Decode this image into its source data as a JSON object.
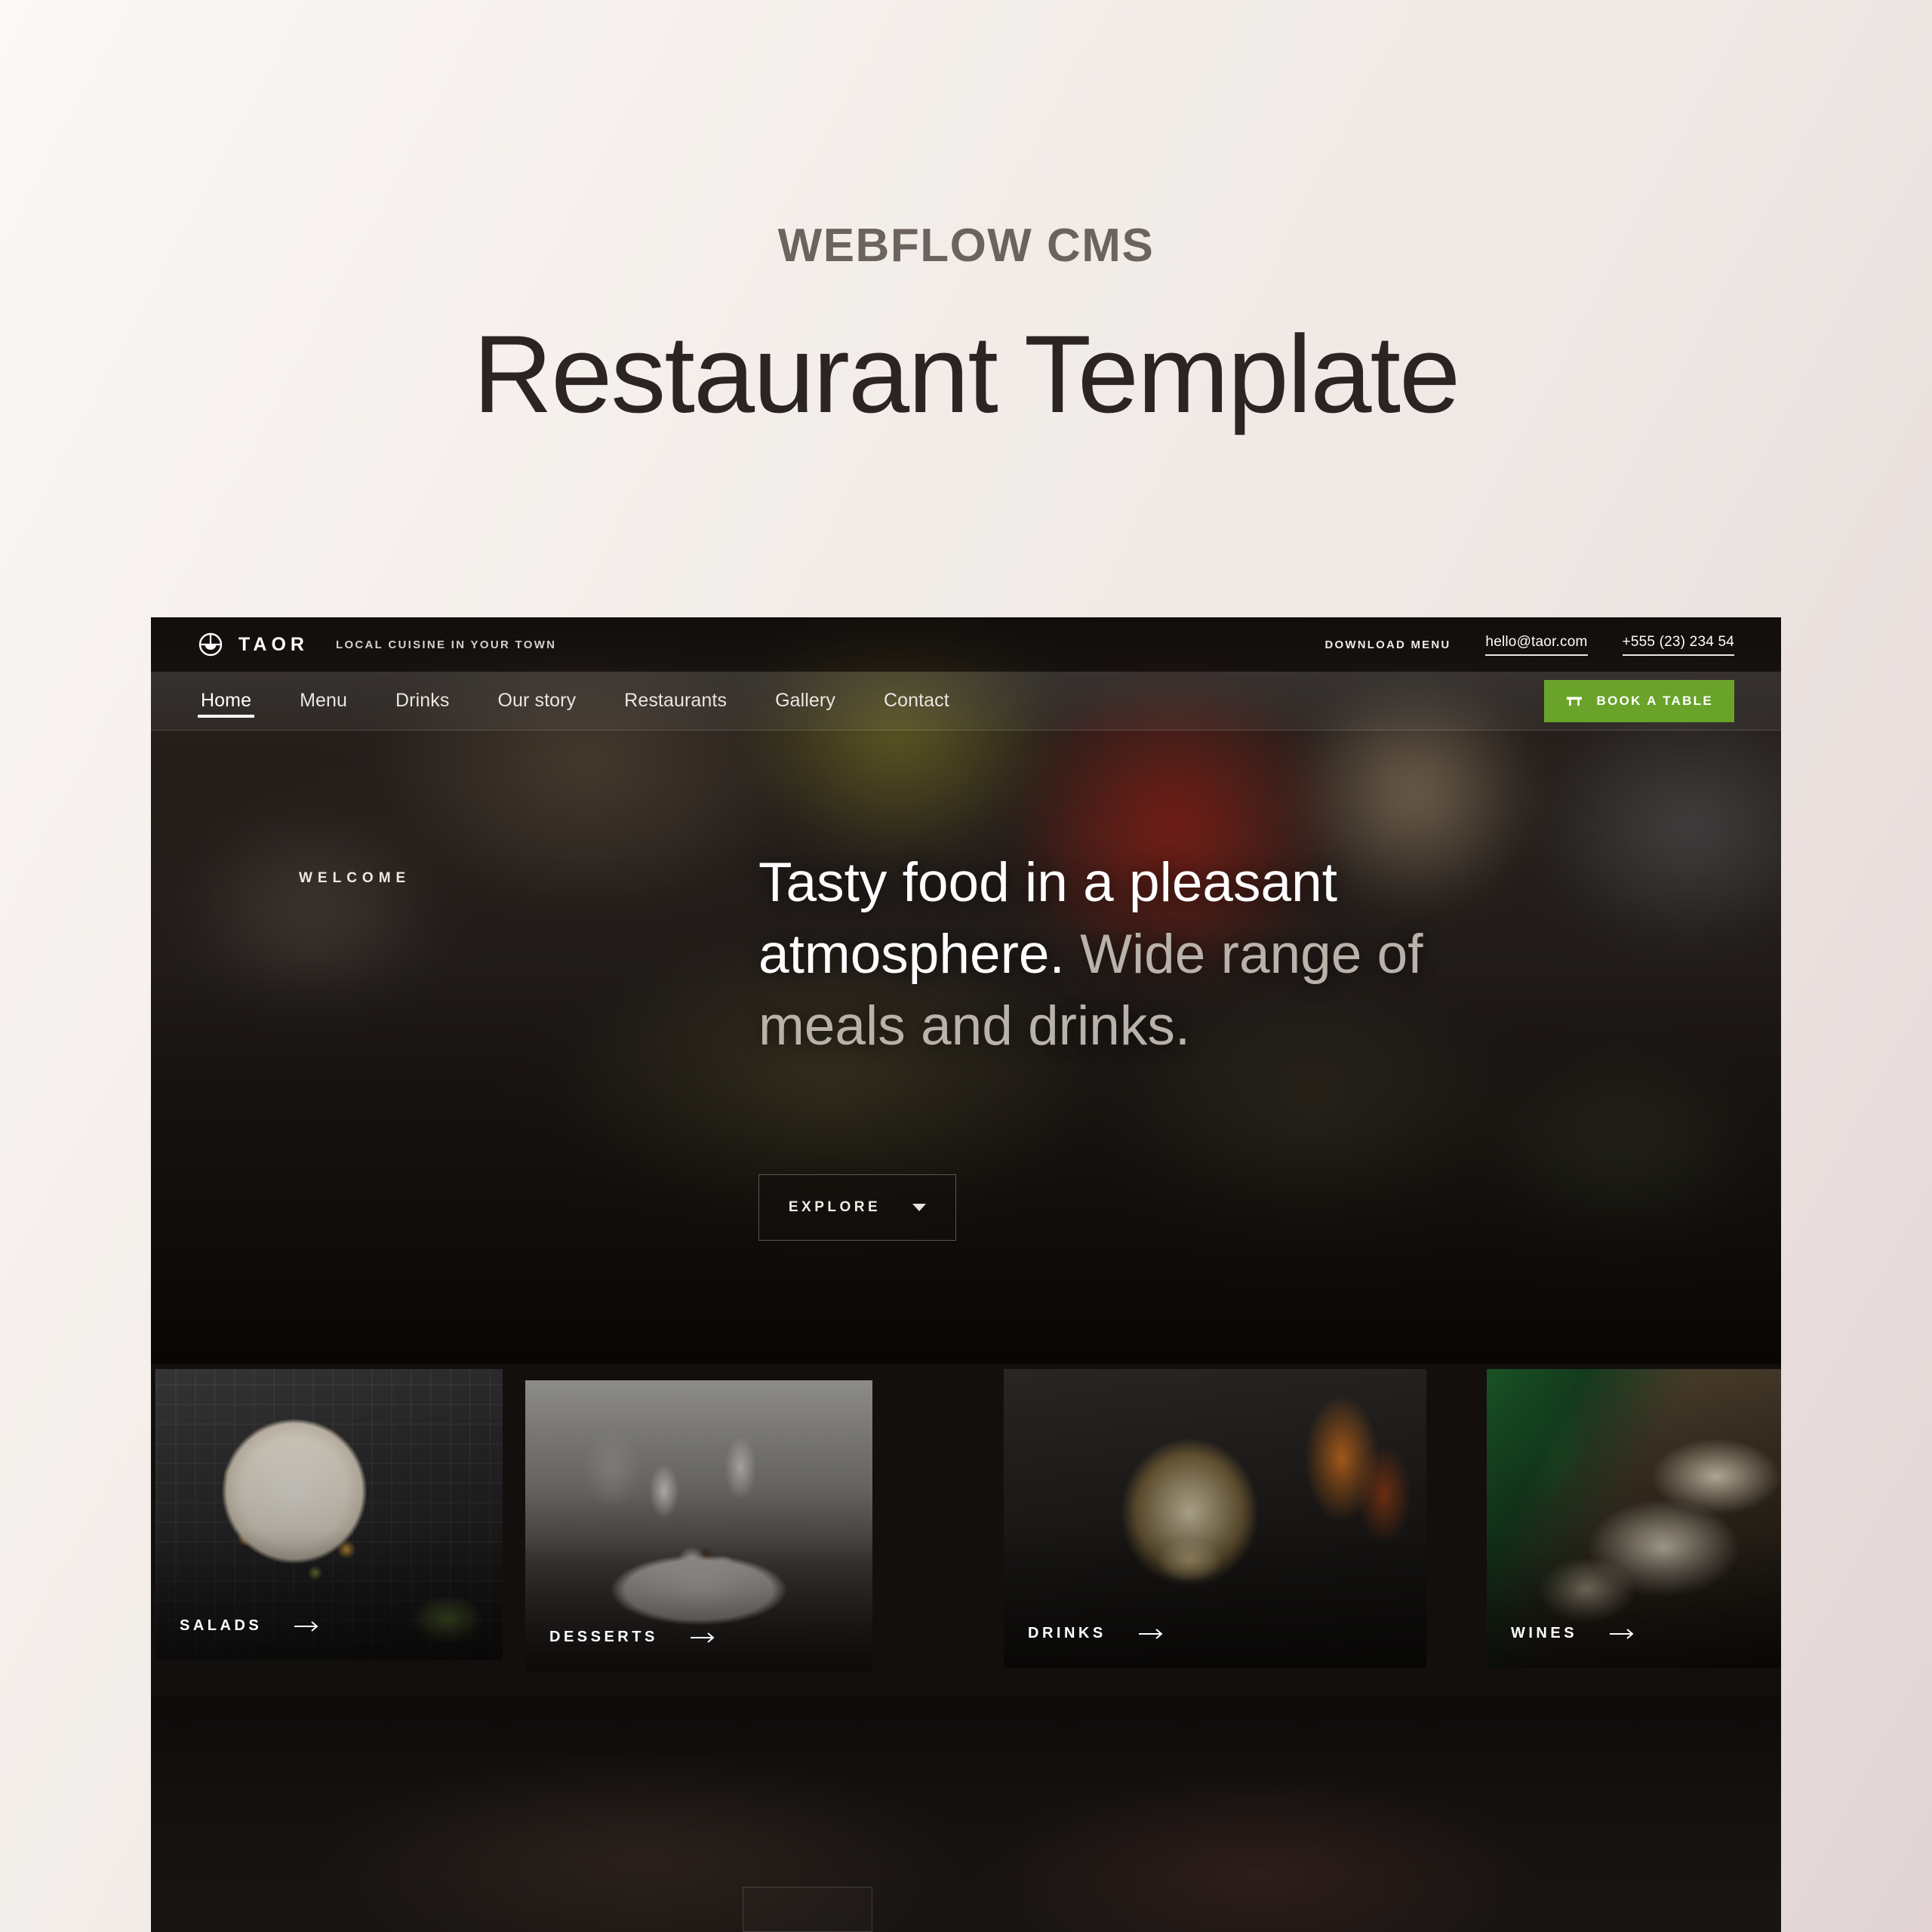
{
  "promo": {
    "eyebrow": "WEBFLOW CMS",
    "title": "Restaurant Template"
  },
  "site": {
    "topbar": {
      "logo_icon": "plate-circle-logo-icon",
      "brand_name": "TAOR",
      "tagline": "LOCAL CUISINE IN YOUR TOWN",
      "download_menu": "DOWNLOAD MENU",
      "email": "hello@taor.com",
      "phone": "+555 (23) 234 54"
    },
    "nav": {
      "items": [
        {
          "label": "Home",
          "active": true
        },
        {
          "label": "Menu",
          "active": false
        },
        {
          "label": "Drinks",
          "active": false
        },
        {
          "label": "Our story",
          "active": false
        },
        {
          "label": "Restaurants",
          "active": false
        },
        {
          "label": "Gallery",
          "active": false
        },
        {
          "label": "Contact",
          "active": false
        }
      ],
      "cta": {
        "label": "BOOK A TABLE",
        "icon": "table-icon",
        "color": "#6aa32a"
      }
    },
    "hero": {
      "eyebrow": "WELCOME",
      "headline_strong": "Tasty food in a pleasant atmosphere.",
      "headline_dim": " Wide range of meals and drinks.",
      "explore_label": "EXPLORE",
      "explore_icon": "chevron-down-icon"
    },
    "categories": [
      {
        "label": "SALADS",
        "icon": "arrow-right-icon"
      },
      {
        "label": "DESSERTS",
        "icon": "arrow-right-icon"
      },
      {
        "label": "DRINKS",
        "icon": "arrow-right-icon"
      },
      {
        "label": "WINES",
        "icon": "arrow-right-icon"
      }
    ]
  },
  "theme": {
    "accent_green": "#6aa32a",
    "page_bg_light": "#f6f1ee",
    "page_bg_dark": "#e2d4d5",
    "heading_color": "#2b2422",
    "eyebrow_color": "#6c635f"
  }
}
